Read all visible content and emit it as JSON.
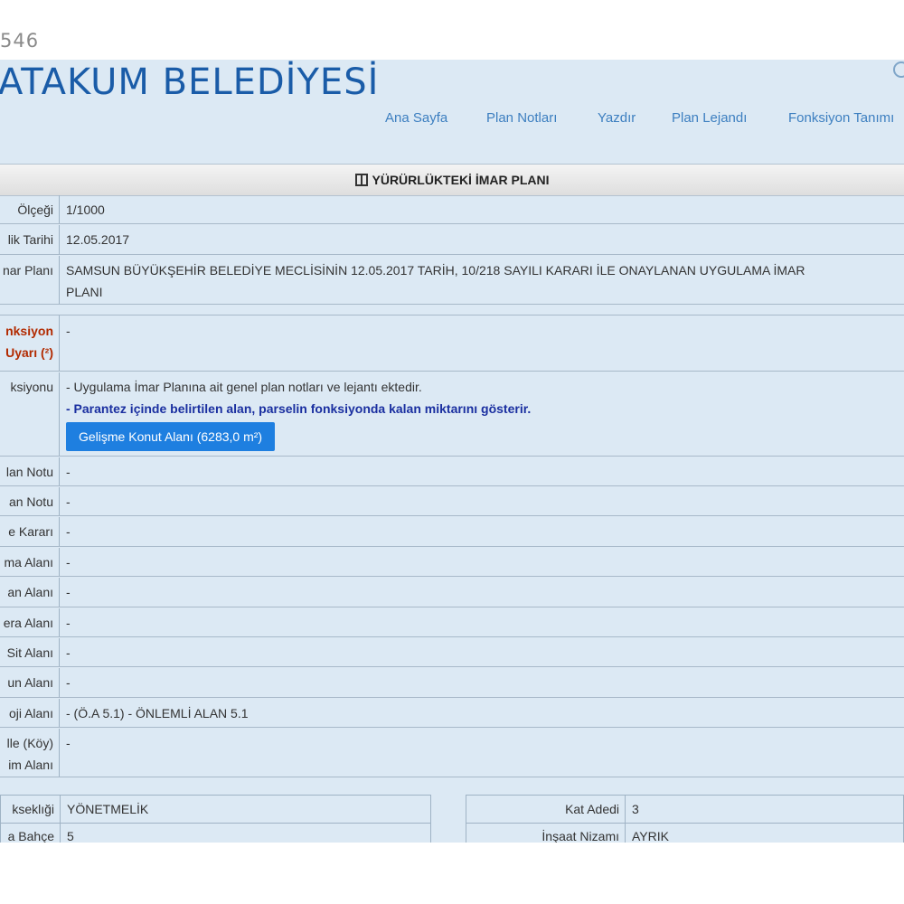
{
  "top_number": "546",
  "header": {
    "title": "ATAKUM BELEDİYESİ",
    "nav": [
      "Ana Sayfa",
      "Plan Notları",
      "Yazdır",
      "Plan Lejandı",
      "Fonksiyon Tanımı"
    ]
  },
  "section_title": "YÜRÜRLÜKTEKİ İMAR PLANI",
  "rows": [
    {
      "label": "Ölçeği",
      "value": "1/1000"
    },
    {
      "label": "lik Tarihi",
      "value": "12.05.2017"
    },
    {
      "label": "nar Planı",
      "value": "SAMSUN BÜYÜKŞEHİR BELEDİYE MECLİSİNİN 12.05.2017 TARİH, 10/218 SAYILI KARARI İLE ONAYLANAN UYGULAMA İMAR",
      "value2": "PLANI"
    },
    {
      "label": "nksiyon",
      "label2": "Uyarı (²)",
      "value": "-"
    },
    {
      "label": "ksiyonu",
      "value": "- Uygulama İmar Planına ait genel plan notları ve lejantı ektedir.",
      "value2": "- Parantez içinde belirtilen alan, parselin fonksiyonda kalan miktarını gösterir.",
      "button": "Gelişme Konut Alanı (6283,0 m²)"
    },
    {
      "label": "lan Notu",
      "value": "-"
    },
    {
      "label": "an Notu",
      "value": "-"
    },
    {
      "label": "e Kararı",
      "value": "-"
    },
    {
      "label": "ma Alanı",
      "value": "-"
    },
    {
      "label": "an Alanı",
      "value": "-"
    },
    {
      "label": "era Alanı",
      "value": "-"
    },
    {
      "label": "Sit Alanı",
      "value": "-"
    },
    {
      "label": "un Alanı",
      "value": "-"
    },
    {
      "label": "oji Alanı",
      "value": "- (Ö.A 5.1) - ÖNLEMLİ ALAN 5.1"
    },
    {
      "label": "lle (Köy)",
      "label2": "im Alanı",
      "value": "-"
    }
  ],
  "bottom_left": [
    {
      "label": "kseklıği",
      "value": "YÖNETMELİK"
    },
    {
      "label": "a Bahçe",
      "value": "5"
    }
  ],
  "bottom_right": [
    {
      "label": "Kat Adedi",
      "value": "3"
    },
    {
      "label": "İnşaat Nizamı",
      "value": "AYRIK"
    }
  ]
}
